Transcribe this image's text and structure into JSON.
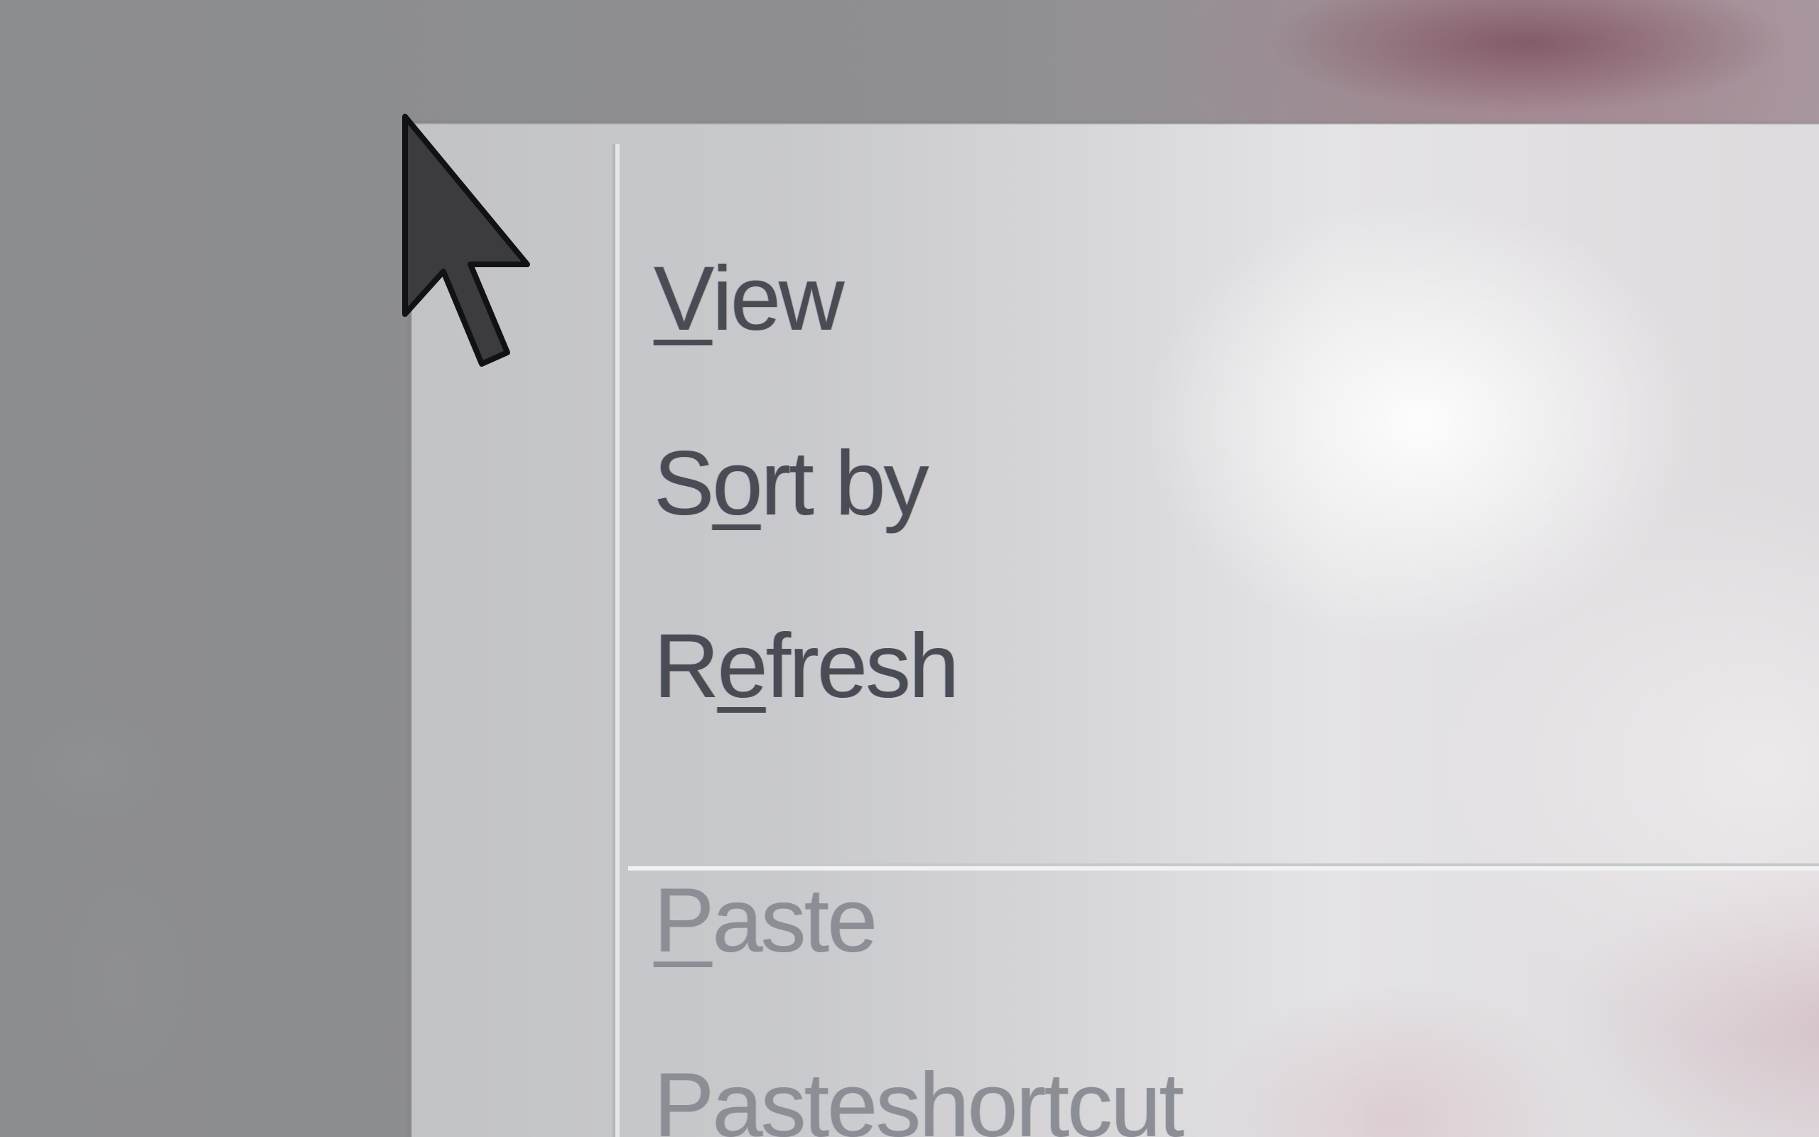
{
  "context_menu": {
    "items": [
      {
        "label": "View",
        "mnemonic": "V",
        "rest": "iew",
        "enabled": true
      },
      {
        "label": "Sort by",
        "pre": "S",
        "mnemonic": "o",
        "rest": "rt by",
        "enabled": true
      },
      {
        "label": "Refresh",
        "pre": "R",
        "mnemonic": "e",
        "rest": "fresh",
        "enabled": true
      },
      {
        "label": "Paste",
        "mnemonic": "P",
        "rest": "aste",
        "enabled": false
      },
      {
        "label": "Paste shortcut",
        "pre": "Paste ",
        "mnemonic": "s",
        "rest": "hortcut",
        "enabled": false
      }
    ]
  },
  "cursor": {
    "icon": "arrow-pointer-icon"
  },
  "colors": {
    "menu_text": "#4a4c55",
    "menu_text_disabled": "#8c8e95",
    "desktop": "#8d8e91"
  }
}
